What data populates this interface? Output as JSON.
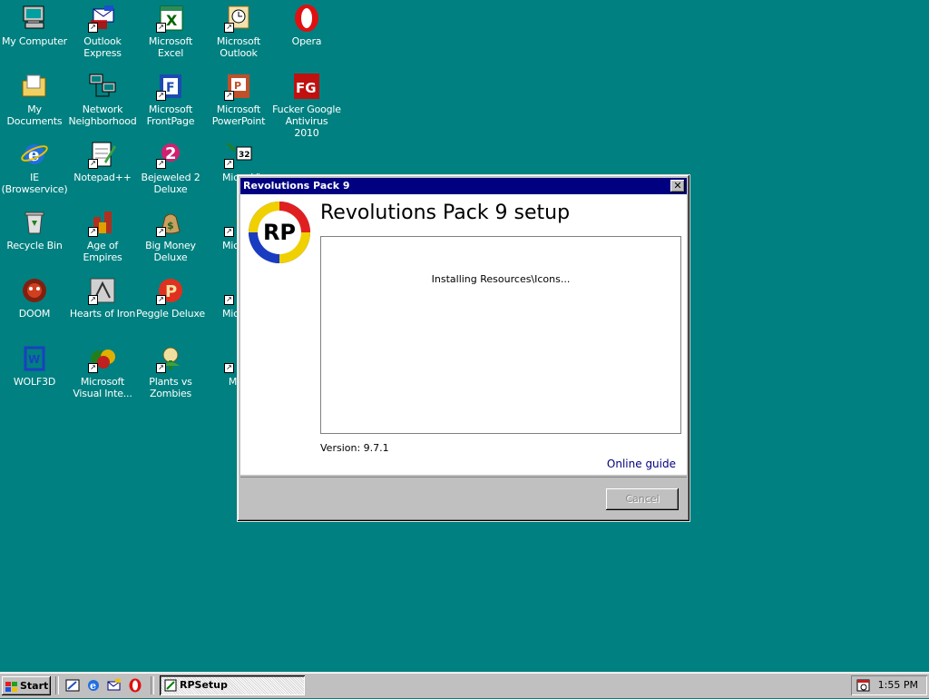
{
  "desktop": {
    "icons": [
      {
        "label": "My Computer",
        "icon": "computer-icon"
      },
      {
        "label": "Outlook Express",
        "icon": "outlook-express-icon"
      },
      {
        "label": "Microsoft Excel",
        "icon": "excel-icon"
      },
      {
        "label": "Microsoft Outlook",
        "icon": "outlook-icon"
      },
      {
        "label": "Opera",
        "icon": "opera-icon"
      },
      {
        "label": "My Documents",
        "icon": "folder-icon"
      },
      {
        "label": "Network Neighborhood",
        "icon": "network-icon"
      },
      {
        "label": "Microsoft FrontPage",
        "icon": "frontpage-icon"
      },
      {
        "label": "Microsoft PowerPoint",
        "icon": "powerpoint-icon"
      },
      {
        "label": "Fucker Google Antivirus 2010",
        "icon": "fg-antivirus-icon"
      },
      {
        "label": "IE (Browservice)",
        "icon": "ie-icon"
      },
      {
        "label": "Notepad++",
        "icon": "notepad-icon"
      },
      {
        "label": "Bejeweled 2 Deluxe",
        "icon": "bejeweled-icon"
      },
      {
        "label": "Micro Visual",
        "icon": "visual-32-icon"
      },
      {
        "label": "Recycle Bin",
        "icon": "recycle-bin-icon"
      },
      {
        "label": "Age of Empires",
        "icon": "age-of-empires-icon"
      },
      {
        "label": "Big Money Deluxe",
        "icon": "big-money-icon"
      },
      {
        "label": "Micr Visual",
        "icon": "visual-icon"
      },
      {
        "label": "DOOM",
        "icon": "doom-icon"
      },
      {
        "label": "Hearts of Iron",
        "icon": "hearts-of-iron-icon"
      },
      {
        "label": "Peggle Deluxe",
        "icon": "peggle-icon"
      },
      {
        "label": "Micr Visual",
        "icon": "visual-fox-icon"
      },
      {
        "label": "WOLF3D",
        "icon": "wolf3d-icon"
      },
      {
        "label": "Microsoft Visual Inte...",
        "icon": "visual-interdev-icon"
      },
      {
        "label": "Plants vs Zombies",
        "icon": "plants-vs-zombies-icon"
      },
      {
        "label": "Micr W",
        "icon": "word-icon"
      }
    ]
  },
  "dialog": {
    "window_title": "Revolutions Pack 9",
    "heading": "Revolutions Pack 9 setup",
    "logo_text": "RP",
    "status": "Installing Resources\\Icons...",
    "version": "Version: 9.7.1",
    "online_guide": "Online guide",
    "cancel_label": "Cancel",
    "close_label": "✕"
  },
  "taskbar": {
    "start_label": "Start",
    "task_label": "RPSetup",
    "clock": "1:55 PM",
    "quick_launch": [
      "show-desktop-icon",
      "ie-icon",
      "outlook-express-icon",
      "opera-icon"
    ]
  },
  "colors": {
    "desktop": "#008080",
    "titlebar": "#000080",
    "window": "#c0c0c0",
    "link": "#000080"
  }
}
